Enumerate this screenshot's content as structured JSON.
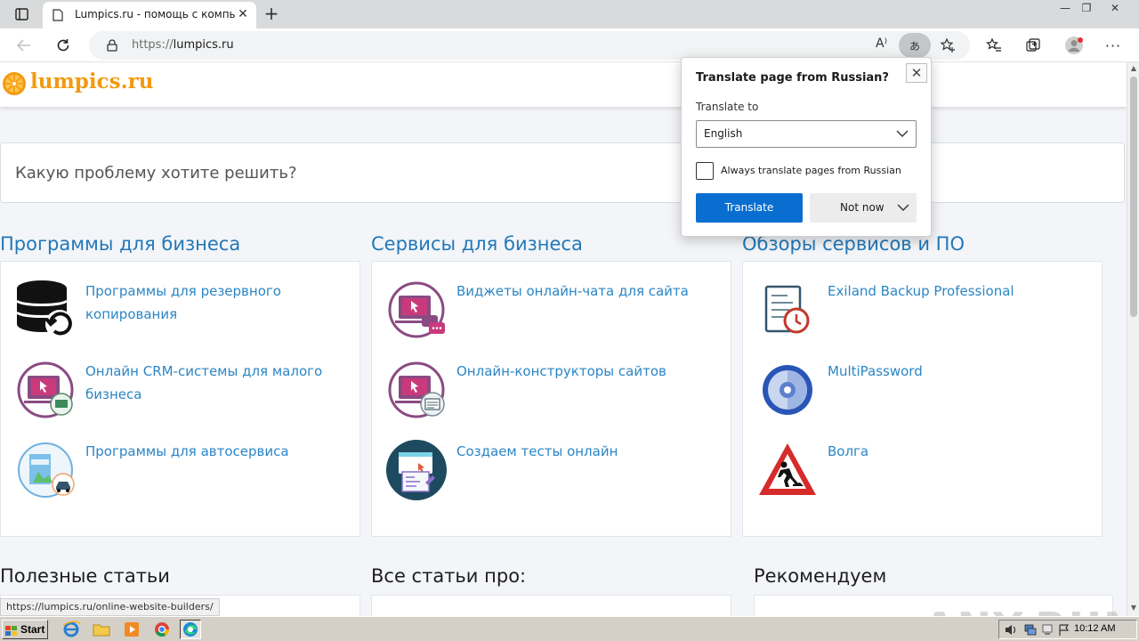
{
  "browser": {
    "tab_title": "Lumpics.ru - помощь с компью",
    "url_scheme": "https://",
    "url_host": "lumpics.ru",
    "translate_icon_text": "あ",
    "read_aloud_icon_text": "A⁾"
  },
  "site": {
    "logo_text": "lumpics.ru",
    "search_placeholder": "Какую проблему хотите решить?",
    "sections": [
      {
        "title": "Программы для бизнеса",
        "items": [
          {
            "label": "Программы для резервного копирования",
            "icon": "database-backup-icon"
          },
          {
            "label": "Онлайн CRM-системы для малого бизнеса",
            "icon": "crm-monitor-icon"
          },
          {
            "label": "Программы для автосервиса",
            "icon": "auto-service-icon"
          }
        ]
      },
      {
        "title": "Сервисы для бизнеса",
        "items": [
          {
            "label": "Виджеты онлайн-чата для сайта",
            "icon": "chat-widget-icon"
          },
          {
            "label": "Онлайн-конструкторы сайтов",
            "icon": "website-builder-icon"
          },
          {
            "label": "Создаем тесты онлайн",
            "icon": "online-test-icon"
          }
        ]
      },
      {
        "title": "Обзоры сервисов и ПО",
        "items": [
          {
            "label": "Exiland Backup Professional",
            "icon": "exiland-backup-icon"
          },
          {
            "label": "MultiPassword",
            "icon": "multipassword-icon"
          },
          {
            "label": "Волга",
            "icon": "road-works-icon"
          }
        ]
      }
    ],
    "bottom_titles": [
      "Полезные статьи",
      "Все статьи про:",
      "Рекомендуем"
    ]
  },
  "status_bar_url": "https://lumpics.ru/online-website-builders/",
  "watermark": "ANY.RUN",
  "translate_popup": {
    "title": "Translate page from Russian?",
    "translate_to_label": "Translate to",
    "selected_language": "English",
    "always_translate_label": "Always translate pages from Russian",
    "always_translate_checked": false,
    "translate_button": "Translate",
    "not_now_button": "Not now"
  },
  "taskbar": {
    "start_label": "Start",
    "clock": "10:12 AM"
  },
  "colors": {
    "link": "#2b86c5",
    "section_title": "#2378b8",
    "logo": "#f29a10",
    "translate_button": "#0a6ed1"
  }
}
